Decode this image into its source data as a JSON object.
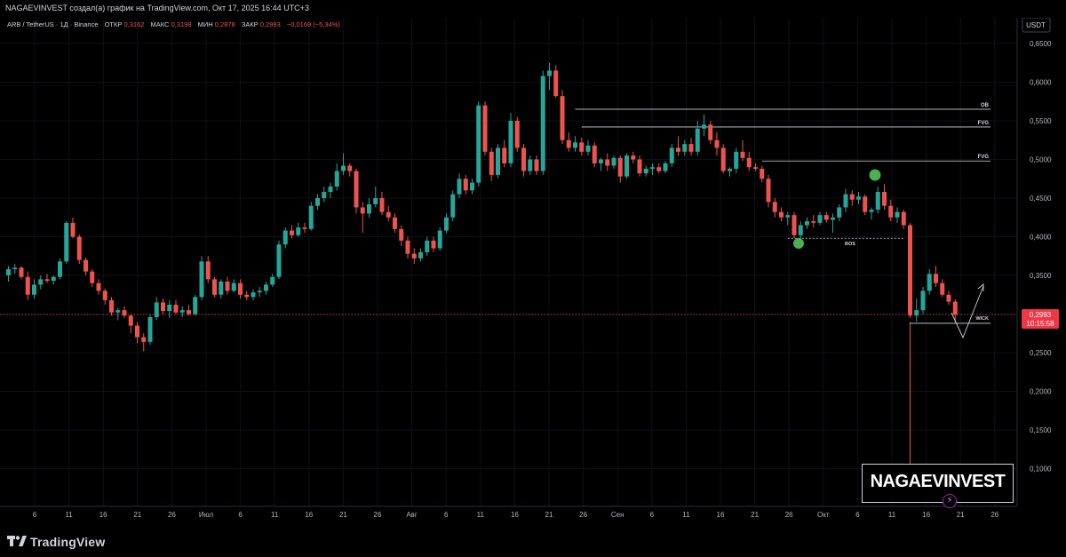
{
  "header": {
    "attribution": "NAGAEVINVEST создал(а) график на TradingView.com, Окт 17, 2025 16:44 UTC+3"
  },
  "legend": {
    "symbol": "ARB / TetherUS · 1Д · Binance",
    "open_label": "ОТКР",
    "open_value": "0,3162",
    "high_label": "МАКС",
    "high_value": "0,3198",
    "low_label": "МИН",
    "low_value": "0,2878",
    "close_label": "ЗАКР",
    "close_value": "0,2993",
    "change": "−0,0169 (−5,34%)"
  },
  "price_axis": {
    "currency": "USDT",
    "labels": [
      "0,6500",
      "0,6000",
      "0,5500",
      "0,5000",
      "0,4500",
      "0,4000",
      "0,3500",
      "0,3000",
      "0,2500",
      "0,2000",
      "0,1500",
      "0,1000"
    ],
    "current_price": "0,2993",
    "countdown": "10:15:58"
  },
  "time_axis": {
    "labels": [
      "6",
      "11",
      "16",
      "21",
      "26",
      "Июл",
      "6",
      "11",
      "16",
      "21",
      "26",
      "Авг",
      "6",
      "11",
      "16",
      "21",
      "26",
      "Сен",
      "6",
      "11",
      "16",
      "21",
      "26",
      "Окт",
      "6",
      "11",
      "16",
      "21",
      "26"
    ]
  },
  "annotations": {
    "ob": "OB",
    "fvg_upper": "FVG",
    "fvg_lower": "FVG",
    "bos": "BOS",
    "wick": "WICK"
  },
  "colors": {
    "up": "#26a69a",
    "down": "#ef5350",
    "background": "#000000",
    "grid": "#0f1117",
    "text": "#d1d4dc",
    "price_tag": "#f23645",
    "marker": "#4caf50"
  },
  "chart_data": {
    "type": "candlestick",
    "interval": "1D",
    "ylim": [
      0.07,
      0.68
    ],
    "grid": true,
    "candles": [
      [
        0.35,
        0.362,
        0.342,
        0.358
      ],
      [
        0.358,
        0.365,
        0.352,
        0.36
      ],
      [
        0.36,
        0.362,
        0.345,
        0.348
      ],
      [
        0.348,
        0.355,
        0.318,
        0.325
      ],
      [
        0.325,
        0.345,
        0.32,
        0.338
      ],
      [
        0.338,
        0.35,
        0.332,
        0.345
      ],
      [
        0.345,
        0.352,
        0.34,
        0.343
      ],
      [
        0.343,
        0.35,
        0.338,
        0.348
      ],
      [
        0.348,
        0.372,
        0.345,
        0.368
      ],
      [
        0.368,
        0.42,
        0.365,
        0.418
      ],
      [
        0.418,
        0.425,
        0.398,
        0.4
      ],
      [
        0.4,
        0.403,
        0.365,
        0.37
      ],
      [
        0.37,
        0.373,
        0.35,
        0.355
      ],
      [
        0.355,
        0.358,
        0.335,
        0.34
      ],
      [
        0.34,
        0.345,
        0.325,
        0.33
      ],
      [
        0.33,
        0.333,
        0.312,
        0.318
      ],
      [
        0.318,
        0.322,
        0.298,
        0.302
      ],
      [
        0.302,
        0.308,
        0.292,
        0.305
      ],
      [
        0.305,
        0.31,
        0.295,
        0.298
      ],
      [
        0.298,
        0.3,
        0.275,
        0.285
      ],
      [
        0.285,
        0.29,
        0.262,
        0.27
      ],
      [
        0.27,
        0.275,
        0.252,
        0.264
      ],
      [
        0.264,
        0.3,
        0.26,
        0.296
      ],
      [
        0.296,
        0.322,
        0.292,
        0.315
      ],
      [
        0.315,
        0.32,
        0.3,
        0.304
      ],
      [
        0.304,
        0.318,
        0.295,
        0.312
      ],
      [
        0.312,
        0.318,
        0.3,
        0.302
      ],
      [
        0.302,
        0.31,
        0.296,
        0.305
      ],
      [
        0.305,
        0.312,
        0.298,
        0.3
      ],
      [
        0.3,
        0.325,
        0.298,
        0.322
      ],
      [
        0.322,
        0.375,
        0.318,
        0.368
      ],
      [
        0.368,
        0.375,
        0.34,
        0.345
      ],
      [
        0.345,
        0.348,
        0.322,
        0.325
      ],
      [
        0.325,
        0.345,
        0.32,
        0.342
      ],
      [
        0.342,
        0.348,
        0.325,
        0.33
      ],
      [
        0.33,
        0.345,
        0.328,
        0.34
      ],
      [
        0.34,
        0.345,
        0.32,
        0.325
      ],
      [
        0.325,
        0.33,
        0.318,
        0.322
      ],
      [
        0.322,
        0.332,
        0.318,
        0.328
      ],
      [
        0.328,
        0.335,
        0.322,
        0.33
      ],
      [
        0.33,
        0.342,
        0.325,
        0.338
      ],
      [
        0.338,
        0.352,
        0.335,
        0.348
      ],
      [
        0.348,
        0.395,
        0.345,
        0.39
      ],
      [
        0.39,
        0.412,
        0.385,
        0.408
      ],
      [
        0.408,
        0.415,
        0.398,
        0.402
      ],
      [
        0.402,
        0.418,
        0.4,
        0.412
      ],
      [
        0.412,
        0.418,
        0.405,
        0.41
      ],
      [
        0.41,
        0.445,
        0.408,
        0.44
      ],
      [
        0.44,
        0.455,
        0.435,
        0.45
      ],
      [
        0.45,
        0.465,
        0.445,
        0.458
      ],
      [
        0.458,
        0.47,
        0.45,
        0.465
      ],
      [
        0.465,
        0.495,
        0.46,
        0.485
      ],
      [
        0.485,
        0.508,
        0.48,
        0.492
      ],
      [
        0.492,
        0.495,
        0.478,
        0.485
      ],
      [
        0.485,
        0.488,
        0.43,
        0.438
      ],
      [
        0.438,
        0.445,
        0.405,
        0.43
      ],
      [
        0.43,
        0.45,
        0.425,
        0.442
      ],
      [
        0.442,
        0.465,
        0.438,
        0.45
      ],
      [
        0.45,
        0.458,
        0.428,
        0.432
      ],
      [
        0.432,
        0.44,
        0.42,
        0.425
      ],
      [
        0.425,
        0.43,
        0.405,
        0.41
      ],
      [
        0.41,
        0.415,
        0.388,
        0.395
      ],
      [
        0.395,
        0.4,
        0.372,
        0.378
      ],
      [
        0.378,
        0.385,
        0.365,
        0.372
      ],
      [
        0.372,
        0.385,
        0.368,
        0.38
      ],
      [
        0.38,
        0.4,
        0.375,
        0.395
      ],
      [
        0.395,
        0.4,
        0.38,
        0.385
      ],
      [
        0.385,
        0.412,
        0.382,
        0.408
      ],
      [
        0.408,
        0.43,
        0.405,
        0.425
      ],
      [
        0.425,
        0.46,
        0.42,
        0.455
      ],
      [
        0.455,
        0.482,
        0.45,
        0.475
      ],
      [
        0.475,
        0.48,
        0.455,
        0.46
      ],
      [
        0.46,
        0.475,
        0.455,
        0.47
      ],
      [
        0.47,
        0.575,
        0.465,
        0.57
      ],
      [
        0.57,
        0.575,
        0.505,
        0.51
      ],
      [
        0.51,
        0.515,
        0.472,
        0.48
      ],
      [
        0.48,
        0.52,
        0.476,
        0.515
      ],
      [
        0.515,
        0.525,
        0.49,
        0.495
      ],
      [
        0.495,
        0.56,
        0.49,
        0.55
      ],
      [
        0.55,
        0.555,
        0.51,
        0.515
      ],
      [
        0.515,
        0.52,
        0.478,
        0.485
      ],
      [
        0.485,
        0.505,
        0.48,
        0.5
      ],
      [
        0.5,
        0.505,
        0.48,
        0.485
      ],
      [
        0.485,
        0.615,
        0.48,
        0.608
      ],
      [
        0.608,
        0.625,
        0.59,
        0.615
      ],
      [
        0.615,
        0.622,
        0.58,
        0.582
      ],
      [
        0.582,
        0.59,
        0.52,
        0.525
      ],
      [
        0.525,
        0.535,
        0.51,
        0.515
      ],
      [
        0.515,
        0.53,
        0.51,
        0.522
      ],
      [
        0.522,
        0.528,
        0.505,
        0.51
      ],
      [
        0.51,
        0.525,
        0.505,
        0.518
      ],
      [
        0.518,
        0.522,
        0.49,
        0.495
      ],
      [
        0.495,
        0.502,
        0.485,
        0.5
      ],
      [
        0.5,
        0.508,
        0.485,
        0.492
      ],
      [
        0.492,
        0.505,
        0.488,
        0.502
      ],
      [
        0.502,
        0.505,
        0.47,
        0.478
      ],
      [
        0.478,
        0.508,
        0.475,
        0.505
      ],
      [
        0.505,
        0.51,
        0.495,
        0.5
      ],
      [
        0.5,
        0.505,
        0.478,
        0.482
      ],
      [
        0.482,
        0.492,
        0.478,
        0.488
      ],
      [
        0.488,
        0.495,
        0.48,
        0.49
      ],
      [
        0.49,
        0.495,
        0.482,
        0.485
      ],
      [
        0.485,
        0.498,
        0.482,
        0.495
      ],
      [
        0.495,
        0.52,
        0.49,
        0.515
      ],
      [
        0.515,
        0.53,
        0.505,
        0.51
      ],
      [
        0.51,
        0.525,
        0.505,
        0.52
      ],
      [
        0.52,
        0.528,
        0.505,
        0.51
      ],
      [
        0.51,
        0.55,
        0.505,
        0.54
      ],
      [
        0.54,
        0.558,
        0.53,
        0.545
      ],
      [
        0.545,
        0.55,
        0.52,
        0.525
      ],
      [
        0.525,
        0.535,
        0.505,
        0.515
      ],
      [
        0.515,
        0.52,
        0.482,
        0.485
      ],
      [
        0.485,
        0.49,
        0.478,
        0.488
      ],
      [
        0.488,
        0.515,
        0.482,
        0.51
      ],
      [
        0.51,
        0.525,
        0.498,
        0.502
      ],
      [
        0.502,
        0.51,
        0.485,
        0.49
      ],
      [
        0.49,
        0.495,
        0.485,
        0.488
      ],
      [
        0.488,
        0.492,
        0.47,
        0.475
      ],
      [
        0.475,
        0.48,
        0.438,
        0.445
      ],
      [
        0.445,
        0.45,
        0.425,
        0.432
      ],
      [
        0.432,
        0.438,
        0.42,
        0.425
      ],
      [
        0.425,
        0.432,
        0.415,
        0.428
      ],
      [
        0.428,
        0.432,
        0.398,
        0.402
      ],
      [
        0.402,
        0.42,
        0.398,
        0.415
      ],
      [
        0.415,
        0.425,
        0.41,
        0.42
      ],
      [
        0.42,
        0.428,
        0.412,
        0.418
      ],
      [
        0.418,
        0.432,
        0.415,
        0.428
      ],
      [
        0.428,
        0.432,
        0.418,
        0.422
      ],
      [
        0.422,
        0.43,
        0.405,
        0.425
      ],
      [
        0.425,
        0.442,
        0.42,
        0.438
      ],
      [
        0.438,
        0.462,
        0.432,
        0.455
      ],
      [
        0.455,
        0.46,
        0.44,
        0.448
      ],
      [
        0.448,
        0.458,
        0.442,
        0.452
      ],
      [
        0.452,
        0.455,
        0.428,
        0.432
      ],
      [
        0.432,
        0.438,
        0.422,
        0.435
      ],
      [
        0.435,
        0.465,
        0.43,
        0.458
      ],
      [
        0.458,
        0.468,
        0.435,
        0.44
      ],
      [
        0.44,
        0.448,
        0.42,
        0.425
      ],
      [
        0.425,
        0.438,
        0.418,
        0.432
      ],
      [
        0.432,
        0.435,
        0.41,
        0.415
      ],
      [
        0.415,
        0.418,
        0.295,
        0.298
      ],
      [
        0.298,
        0.32,
        0.29,
        0.305
      ],
      [
        0.305,
        0.335,
        0.3,
        0.33
      ],
      [
        0.33,
        0.358,
        0.325,
        0.352
      ],
      [
        0.352,
        0.362,
        0.335,
        0.34
      ],
      [
        0.34,
        0.345,
        0.322,
        0.325
      ],
      [
        0.325,
        0.33,
        0.312,
        0.316
      ],
      [
        0.316,
        0.319,
        0.288,
        0.299
      ]
    ],
    "levels": [
      {
        "label": "OB",
        "price": 0.565
      },
      {
        "label": "FVG",
        "price": 0.542
      },
      {
        "label": "FVG",
        "price": 0.498
      },
      {
        "label": "BOS",
        "price": 0.398
      },
      {
        "label": "WICK",
        "price": 0.288
      }
    ],
    "current_price": 0.2993
  }
}
